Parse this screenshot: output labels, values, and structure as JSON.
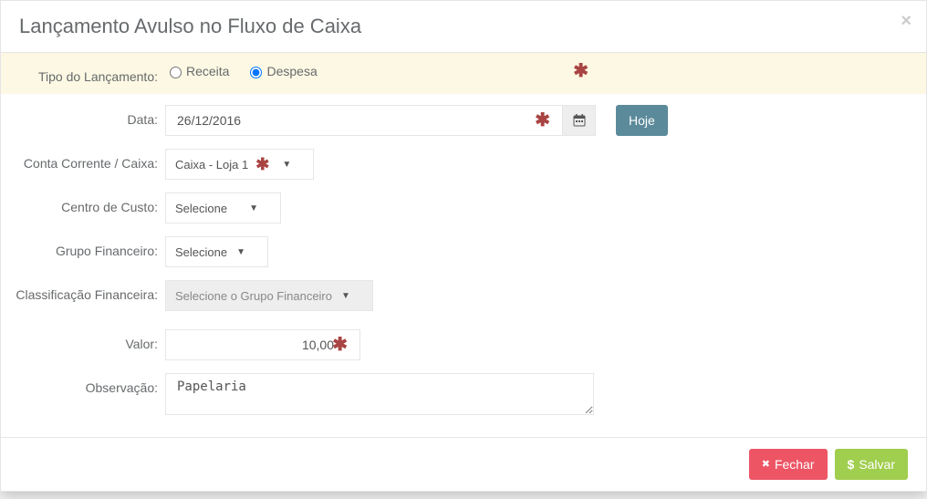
{
  "modal": {
    "title": "Lançamento Avulso no Fluxo de Caixa",
    "close_symbol": "×"
  },
  "labels": {
    "tipo_lancamento": "Tipo do Lançamento:",
    "data": "Data:",
    "conta_corrente": "Conta Corrente / Caixa:",
    "centro_custo": "Centro de Custo:",
    "grupo_financeiro": "Grupo Financeiro:",
    "classificacao_financeira": "Classificação Financeira:",
    "valor": "Valor:",
    "observacao": "Observação:"
  },
  "tipo_lancamento": {
    "receita_label": "Receita",
    "despesa_label": "Despesa",
    "selected": "despesa"
  },
  "data": {
    "value": "26/12/2016",
    "hoje_label": "Hoje"
  },
  "conta_corrente": {
    "selected": "Caixa - Loja 1"
  },
  "centro_custo": {
    "selected": "Selecione"
  },
  "grupo_financeiro": {
    "selected": "Selecione"
  },
  "classificacao_financeira": {
    "selected": "Selecione o Grupo Financeiro"
  },
  "valor": {
    "value": "10,00"
  },
  "observacao": {
    "value": "Papelaria"
  },
  "footer": {
    "fechar_label": "Fechar",
    "salvar_label": "Salvar"
  },
  "symbols": {
    "asterisk": "✱",
    "caret": "▼",
    "calendar": "📅",
    "close_x": "✖",
    "dollar": "$"
  }
}
